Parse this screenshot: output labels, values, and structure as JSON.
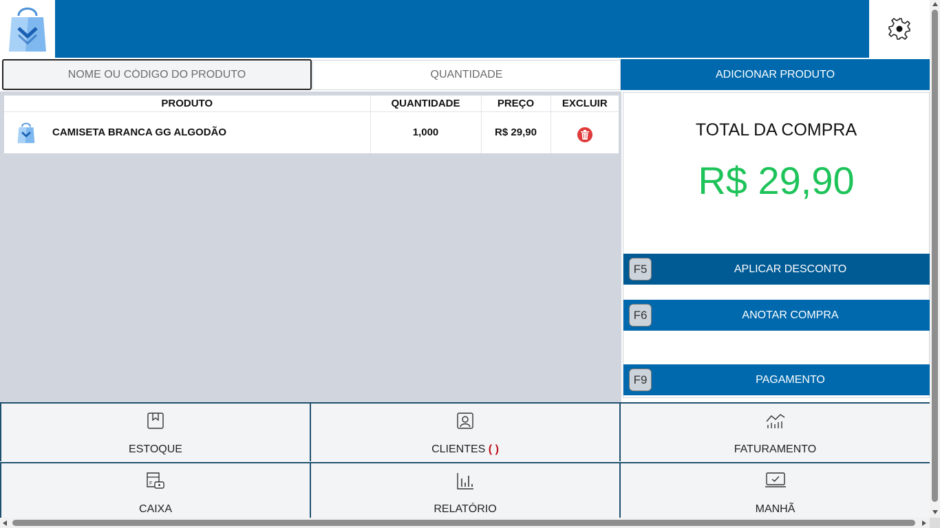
{
  "header": {
    "logo_icon": "shopping-bag-logo",
    "bar_color": "#0069ad",
    "settings_icon": "gear-icon"
  },
  "inputs": {
    "product_placeholder": "NOME OU CÓDIGO DO PRODUTO",
    "quantity_placeholder": "QUANTIDADE",
    "add_button_label": "ADICIONAR PRODUTO"
  },
  "table": {
    "columns": [
      "PRODUTO",
      "QUANTIDADE",
      "PREÇO",
      "EXCLUIR"
    ],
    "rows": [
      {
        "icon": "shopping-bag-icon",
        "name": "CAMISETA BRANCA GG ALGODÃO",
        "quantity": "1,000",
        "price": "R$ 29,90",
        "delete_icon": "trash-icon"
      }
    ]
  },
  "summary": {
    "total_label": "TOTAL DA COMPRA",
    "total_value": "R$ 29,90",
    "total_color": "#1ec35a"
  },
  "actions": [
    {
      "key": "F5",
      "label": "APLICAR DESCONTO"
    },
    {
      "key": "F6",
      "label": "ANOTAR COMPRA"
    },
    {
      "key": "F9",
      "label": "PAGAMENTO"
    }
  ],
  "nav": [
    {
      "label": "ESTOQUE",
      "icon": "box-icon"
    },
    {
      "label": "CLIENTES",
      "suffix": "( )",
      "icon": "user-card-icon"
    },
    {
      "label": "FATURAMENTO",
      "icon": "trend-chart-icon"
    },
    {
      "label": "CAIXA",
      "icon": "cash-register-icon"
    },
    {
      "label": "RELATÓRIO",
      "icon": "bar-chart-icon"
    },
    {
      "label": "MANHÃ",
      "icon": "monitor-check-icon"
    }
  ]
}
